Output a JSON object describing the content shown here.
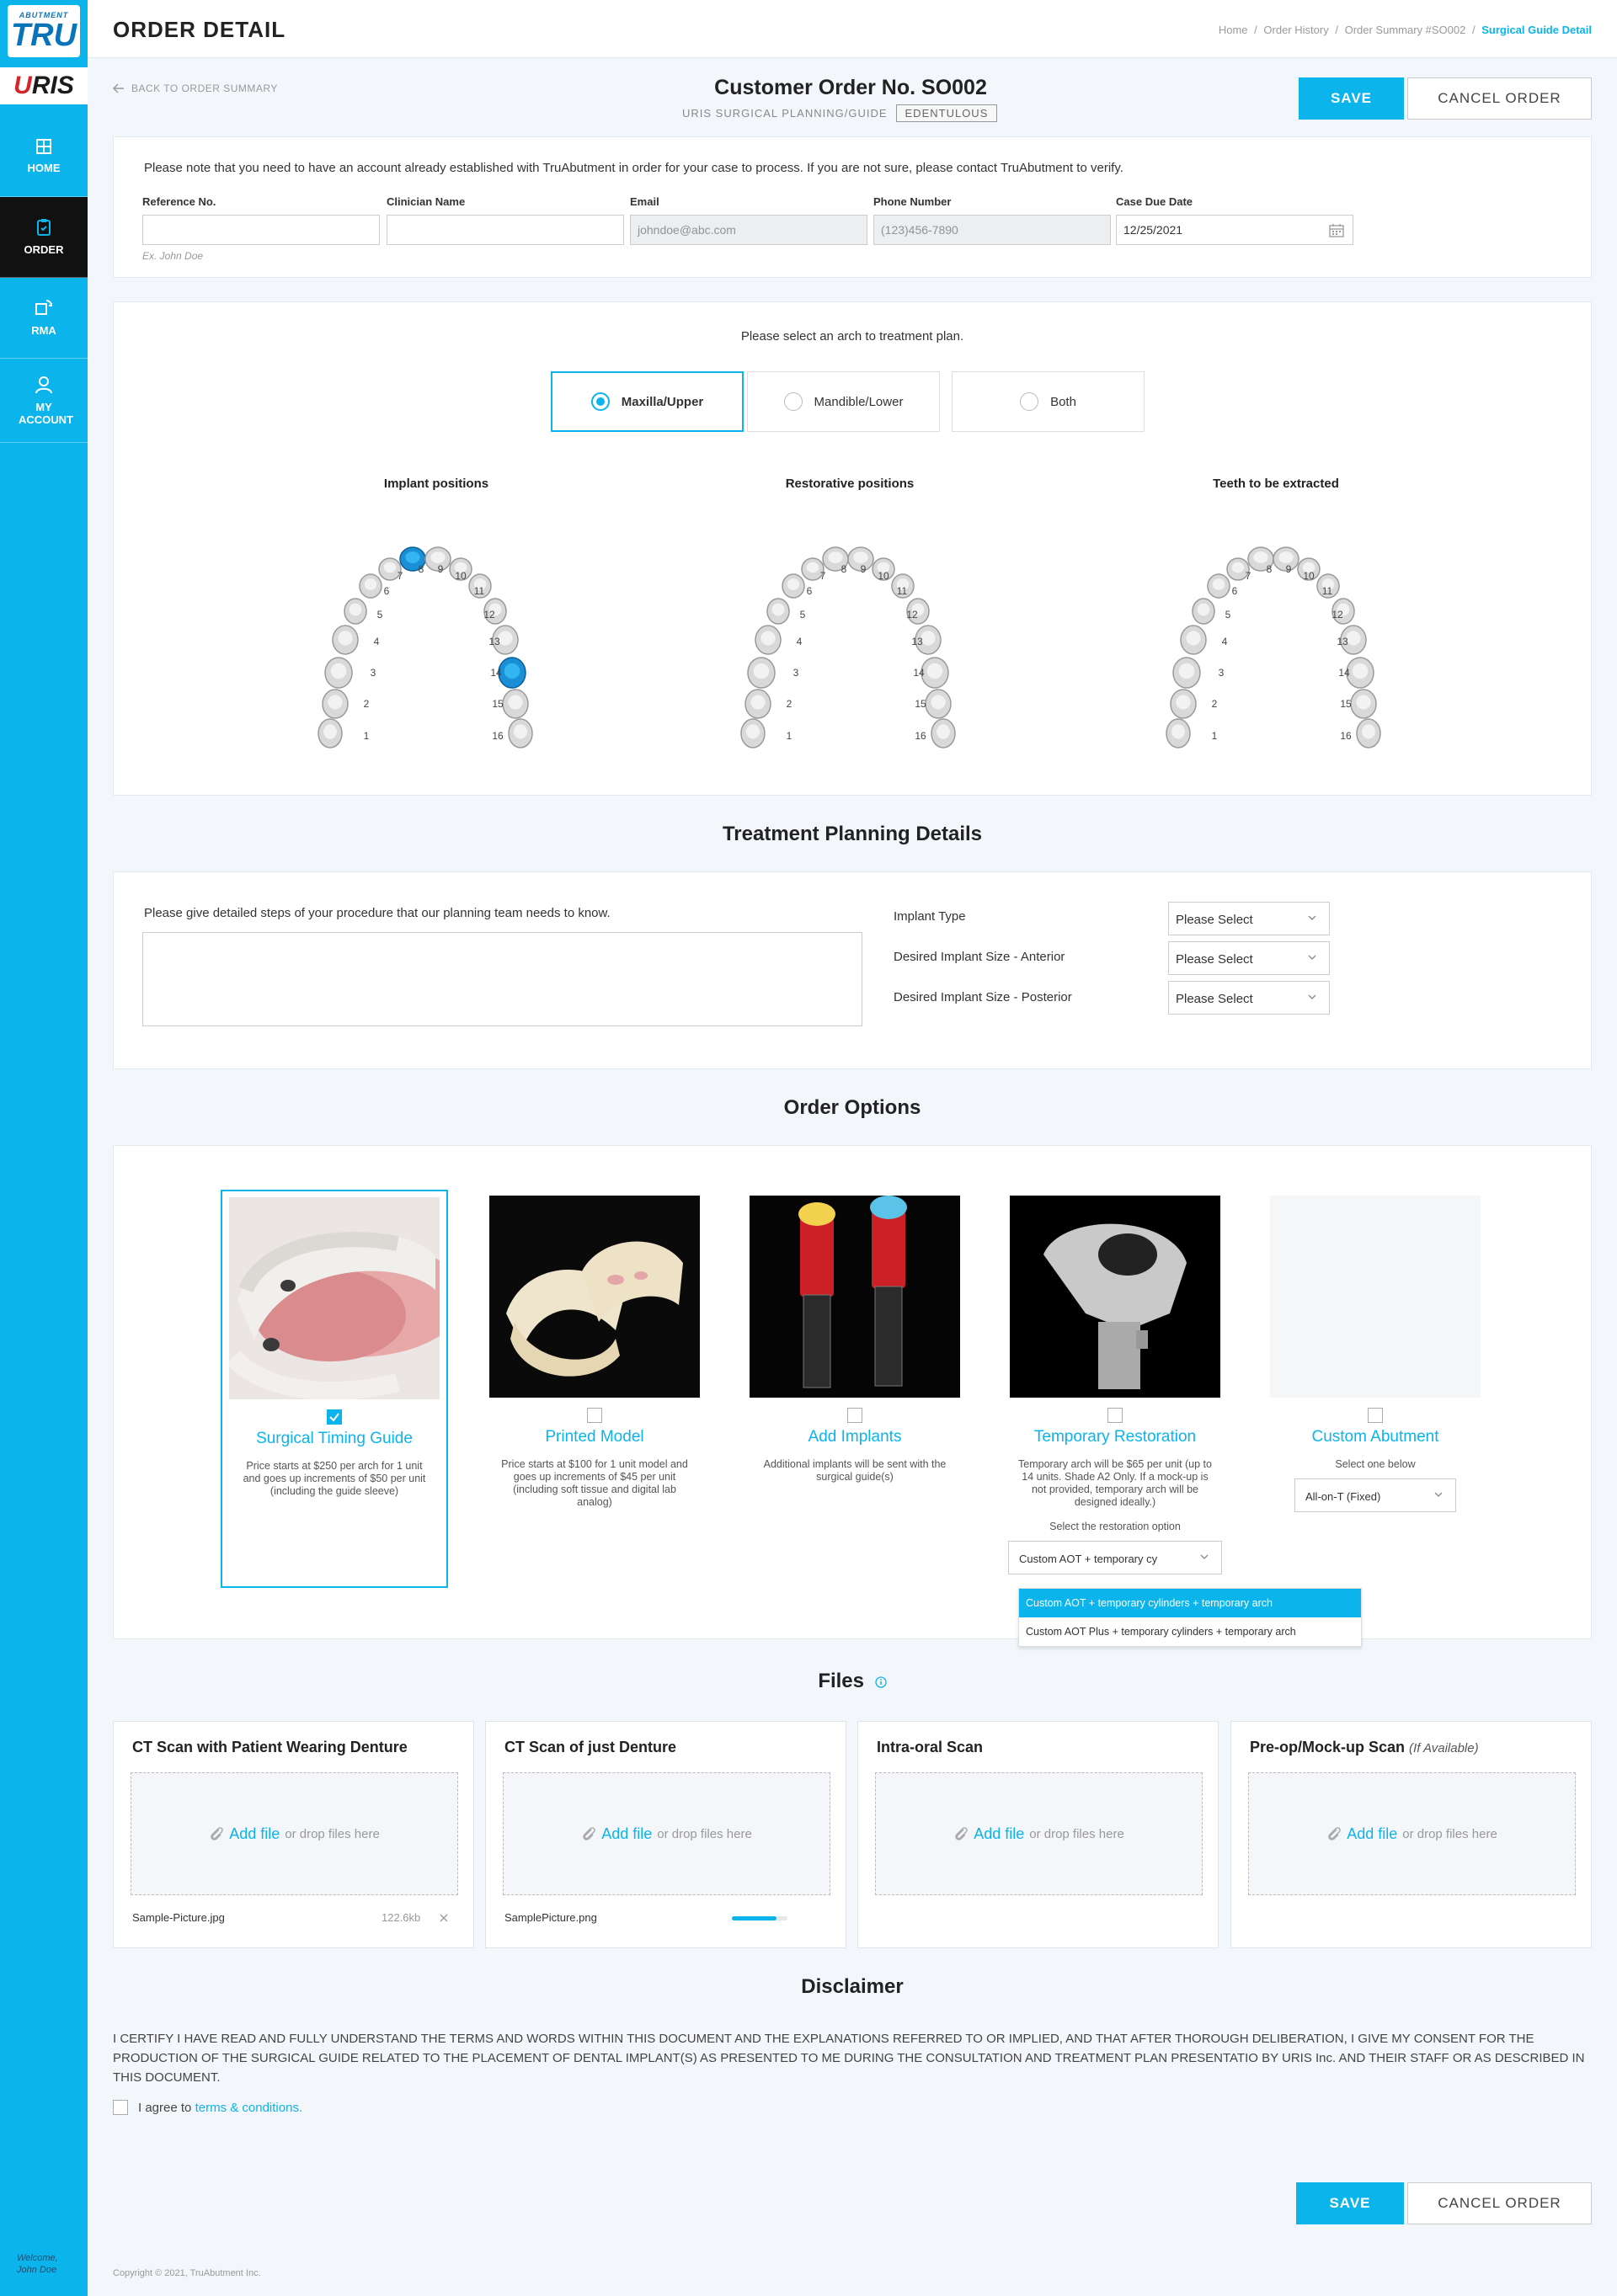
{
  "sidebar": {
    "logo_top": "ABUTMENT",
    "logo_main": "TRU",
    "brand_u": "U",
    "brand_rest": "RIS",
    "items": [
      {
        "label": "HOME",
        "icon": "home-icon"
      },
      {
        "label": "ORDER",
        "icon": "order-icon"
      },
      {
        "label": "RMA",
        "icon": "rma-icon"
      },
      {
        "label": "MY ACCOUNT",
        "icon": "account-icon"
      }
    ],
    "welcome_line1": "Welcome,",
    "welcome_line2": "John Doe"
  },
  "header": {
    "title": "ORDER DETAIL",
    "breadcrumb": [
      "Home",
      "Order History",
      "Order Summary #SO002",
      "Surgical Guide Detail"
    ],
    "separator": "/"
  },
  "topbar": {
    "back_label": "BACK TO ORDER SUMMARY",
    "order_title": "Customer Order No. SO002",
    "order_subtitle": "URIS SURGICAL PLANNING/GUIDE",
    "order_tag": "EDENTULOUS",
    "save_label": "SAVE",
    "cancel_label": "CANCEL ORDER"
  },
  "info": {
    "notice": "Please note that you need to have an account already established with TruAbutment in order for your case to process. If you are not sure, please contact TruAbutment to verify.",
    "reference_label": "Reference No.",
    "reference_value": "",
    "reference_hint": "Ex. John Doe",
    "clinician_label": "Clinician Name",
    "clinician_value": "",
    "email_label": "Email",
    "email_value": "johndoe@abc.com",
    "phone_label": "Phone Number",
    "phone_value": "(123)456-7890",
    "due_label": "Case Due Date",
    "due_value": "12/25/2021"
  },
  "arch": {
    "prompt": "Please select an arch to treatment plan.",
    "options": [
      "Maxilla/Upper",
      "Mandible/Lower",
      "Both"
    ],
    "selected": "Maxilla/Upper",
    "charts": [
      {
        "title": "Implant positions",
        "highlighted": [
          8,
          14
        ]
      },
      {
        "title": "Restorative positions",
        "highlighted": []
      },
      {
        "title": "Teeth to be extracted",
        "highlighted": []
      }
    ],
    "tooth_numbers": [
      "1",
      "2",
      "3",
      "4",
      "5",
      "6",
      "7",
      "8",
      "9",
      "10",
      "11",
      "12",
      "13",
      "14",
      "15",
      "16"
    ]
  },
  "treatment": {
    "section_title": "Treatment Planning Details",
    "prompt": "Please give detailed steps of your procedure that our planning team needs to know.",
    "text_value": "",
    "implant_type_label": "Implant Type",
    "implant_type_value": "Please Select",
    "anterior_label": "Desired Implant Size - Anterior",
    "anterior_value": "Please Select",
    "posterior_label": "Desired Implant Size - Posterior",
    "posterior_value": "Please Select"
  },
  "options": {
    "section_title": "Order Options",
    "items": [
      {
        "title": "Surgical Timing Guide",
        "checked": true,
        "desc": "Price starts at $250 per arch for 1 unit and goes up increments of $50 per unit (including the guide sleeve)"
      },
      {
        "title": "Printed Model",
        "checked": false,
        "desc": "Price starts at $100 for 1 unit model and goes up increments of $45 per unit (including soft tissue and digital lab analog)"
      },
      {
        "title": "Add Implants",
        "checked": false,
        "desc": "Additional implants will be sent with the surgical guide(s)"
      },
      {
        "title": "Temporary Restoration",
        "checked": false,
        "desc": "Temporary arch will be $65 per unit (up to 14 units. Shade A2 Only. If a mock-up is not provided, temporary arch will be designed ideally.)",
        "select_label": "Select the restoration option",
        "select_value": "Custom AOT + temporary cy"
      },
      {
        "title": "Custom Abutment",
        "checked": false,
        "select_label": "Select one below",
        "select_value": "All-on-T (Fixed)"
      }
    ],
    "dropdown": [
      "Custom AOT + temporary cylinders + temporary arch",
      "Custom AOT Plus + temporary cylinders + temporary arch"
    ]
  },
  "files": {
    "section_title": "Files",
    "add_label": "Add file",
    "drop_label": "or drop files here",
    "cards": [
      {
        "title": "CT Scan with Patient Wearing Denture",
        "note": "",
        "file": "Sample-Picture.jpg",
        "size": "122.6kb"
      },
      {
        "title": "CT Scan of just Denture",
        "note": "",
        "file": "SamplePicture.png",
        "progress": 0.8
      },
      {
        "title": "Intra-oral Scan",
        "note": ""
      },
      {
        "title": "Pre-op/Mock-up Scan",
        "note": "(If Available)"
      }
    ]
  },
  "disclaimer": {
    "section_title": "Disclaimer",
    "text": "I CERTIFY I HAVE READ AND FULLY UNDERSTAND THE TERMS AND WORDS WITHIN THIS DOCUMENT AND THE EXPLANATIONS REFERRED TO OR IMPLIED, AND THAT AFTER THOROUGH DELIBERATION, I GIVE MY CONSENT FOR THE PRODUCTION OF THE SURGICAL GUIDE RELATED TO THE PLACEMENT OF DENTAL IMPLANT(S) AS PRESENTED TO ME DURING THE CONSULTATION AND TREATMENT PLAN PRESENTATIO BY URIS Inc. AND THEIR STAFF OR AS DESCRIBED IN THIS DOCUMENT.",
    "agree_prefix": "I agree to",
    "agree_link": "terms & conditions."
  },
  "footer": {
    "copyright": "Copyright © 2021, TruAbutment Inc.",
    "save_label": "SAVE",
    "cancel_label": "CANCEL ORDER"
  },
  "colors": {
    "accent": "#0cb4ec",
    "sidebar": "#0cb4ec",
    "active_nav": "#111111",
    "brand_red": "#d6262d"
  }
}
